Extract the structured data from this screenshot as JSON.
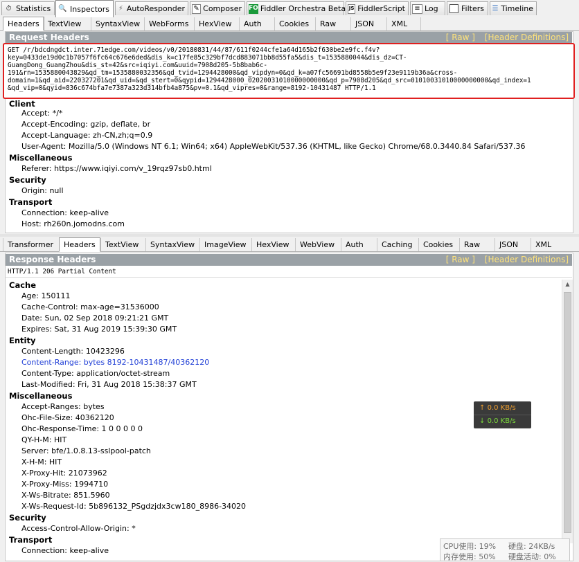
{
  "top_tabs": [
    {
      "label": "Statistics",
      "icon": "stopwatch-icon"
    },
    {
      "label": "Inspectors",
      "icon": "inspector-magnifier-icon"
    },
    {
      "label": "AutoResponder",
      "icon": "lightning-icon"
    },
    {
      "label": "Composer",
      "icon": "pencil-icon"
    },
    {
      "label": "Fiddler Orchestra Beta",
      "icon": "fo-icon"
    },
    {
      "label": "FiddlerScript",
      "icon": "js-icon"
    },
    {
      "label": "Log",
      "icon": "log-icon"
    },
    {
      "label": "Filters",
      "icon": "checkbox-icon"
    },
    {
      "label": "Timeline",
      "icon": "timeline-icon"
    }
  ],
  "fo_badge": "FO",
  "js_badge": "JS",
  "request_tabs": [
    "Headers",
    "TextView",
    "SyntaxView",
    "WebForms",
    "HexView",
    "Auth",
    "Cookies",
    "Raw",
    "JSON",
    "XML"
  ],
  "request": {
    "title": "Request Headers",
    "raw_link": "[ Raw ]",
    "defs_link": "[Header Definitions]",
    "raw_lines": [
      "GET /r/bdcdngdct.inter.71edge.com/videos/v0/20180831/44/87/611f0244cfe1a64d165b2f630be2e9fc.f4v?",
      "key=0433de19d0c1b7057f6fc64c676e6ded&dis_k=c17fe85c329bf7dcd883071bb8d55fa5&dis_t=1535880044&dis_dz=CT-",
      "GuangDong_GuangZhou&dis_st=42&src=iqiyi.com&uuid=7908d205-5b8bab6c-",
      "191&rn=1535880043829&qd_tm=1535880032356&qd_tvid=1294428000&qd_vipdyn=0&qd_k=a07fc56691bd8558b5e9f23e9119b36a&cross-",
      "domain=1&qd_aid=220327201&qd_uid=&qd_stert=0&qypid=1294428000_02020031010000000000&qd_p=7908d205&qd_src=01010031010000000000&qd_index=1",
      "&qd_vip=0&qyid=836c674bfa7e7387a323d314bfb4a875&pv=0.1&qd_vipres=0&range=8192-10431487 HTTP/1.1"
    ],
    "groups": [
      {
        "name": "Client",
        "items": [
          "Accept: */*",
          "Accept-Encoding: gzip, deflate, br",
          "Accept-Language: zh-CN,zh;q=0.9",
          "User-Agent: Mozilla/5.0 (Windows NT 6.1; Win64; x64) AppleWebKit/537.36 (KHTML, like Gecko) Chrome/68.0.3440.84 Safari/537.36"
        ]
      },
      {
        "name": "Miscellaneous",
        "items": [
          "Referer: https://www.iqiyi.com/v_19rqz97sb0.html"
        ]
      },
      {
        "name": "Security",
        "items": [
          "Origin: null"
        ]
      },
      {
        "name": "Transport",
        "items": [
          "Connection: keep-alive",
          "Host: rh260n.jomodns.com"
        ]
      }
    ]
  },
  "response_tabs": [
    "Transformer",
    "Headers",
    "TextView",
    "SyntaxView",
    "ImageView",
    "HexView",
    "WebView",
    "Auth",
    "Caching",
    "Cookies",
    "Raw",
    "JSON",
    "XML"
  ],
  "response": {
    "title": "Response Headers",
    "raw_link": "[ Raw ]",
    "defs_link": "[Header Definitions]",
    "status_line": "HTTP/1.1 206 Partial Content",
    "groups": [
      {
        "name": "Cache",
        "items": [
          "Age: 150111",
          "Cache-Control: max-age=31536000",
          "Date: Sun, 02 Sep 2018 09:21:21 GMT",
          "Expires: Sat, 31 Aug 2019 15:39:30 GMT"
        ]
      },
      {
        "name": "Entity",
        "items": [
          "Content-Length: 10423296",
          "Content-Range: bytes 8192-10431487/40362120",
          "Content-Type: application/octet-stream",
          "Last-Modified: Fri, 31 Aug 2018 15:38:37 GMT"
        ]
      },
      {
        "name": "Miscellaneous",
        "items": [
          "Accept-Ranges: bytes",
          "Ohc-File-Size: 40362120",
          "Ohc-Response-Time: 1 0 0 0 0 0",
          "QY-H-M: HIT",
          "Server: bfe/1.0.8.13-sslpool-patch",
          "X-H-M: HIT",
          "X-Proxy-Hit: 21073962",
          "X-Proxy-Miss: 1994710",
          "X-Ws-Bitrate: 851.5960",
          "X-Ws-Request-Id: 5b896132_PSgdzjdx3cw180_8986-34020"
        ]
      },
      {
        "name": "Security",
        "items": [
          "Access-Control-Allow-Origin: *"
        ]
      },
      {
        "name": "Transport",
        "items": [
          "Connection: keep-alive"
        ]
      }
    ]
  },
  "speed": {
    "up": "0.0 KB/s",
    "down": "0.0 KB/s",
    "up_color": "#f0a030",
    "down_color": "#7ddc3c"
  },
  "sysmon": {
    "cpu": "CPU使用: 19%",
    "disk_rate": "硬盘: 24KB/s",
    "mem": "内存使用: 50%",
    "disk_act": "硬盘活动: 0%"
  },
  "colors": {
    "highlight_box": "#e02020",
    "link_text": "#1f3ed6",
    "header_bar": "#9aa1a6",
    "header_links": "#ffe37a"
  }
}
